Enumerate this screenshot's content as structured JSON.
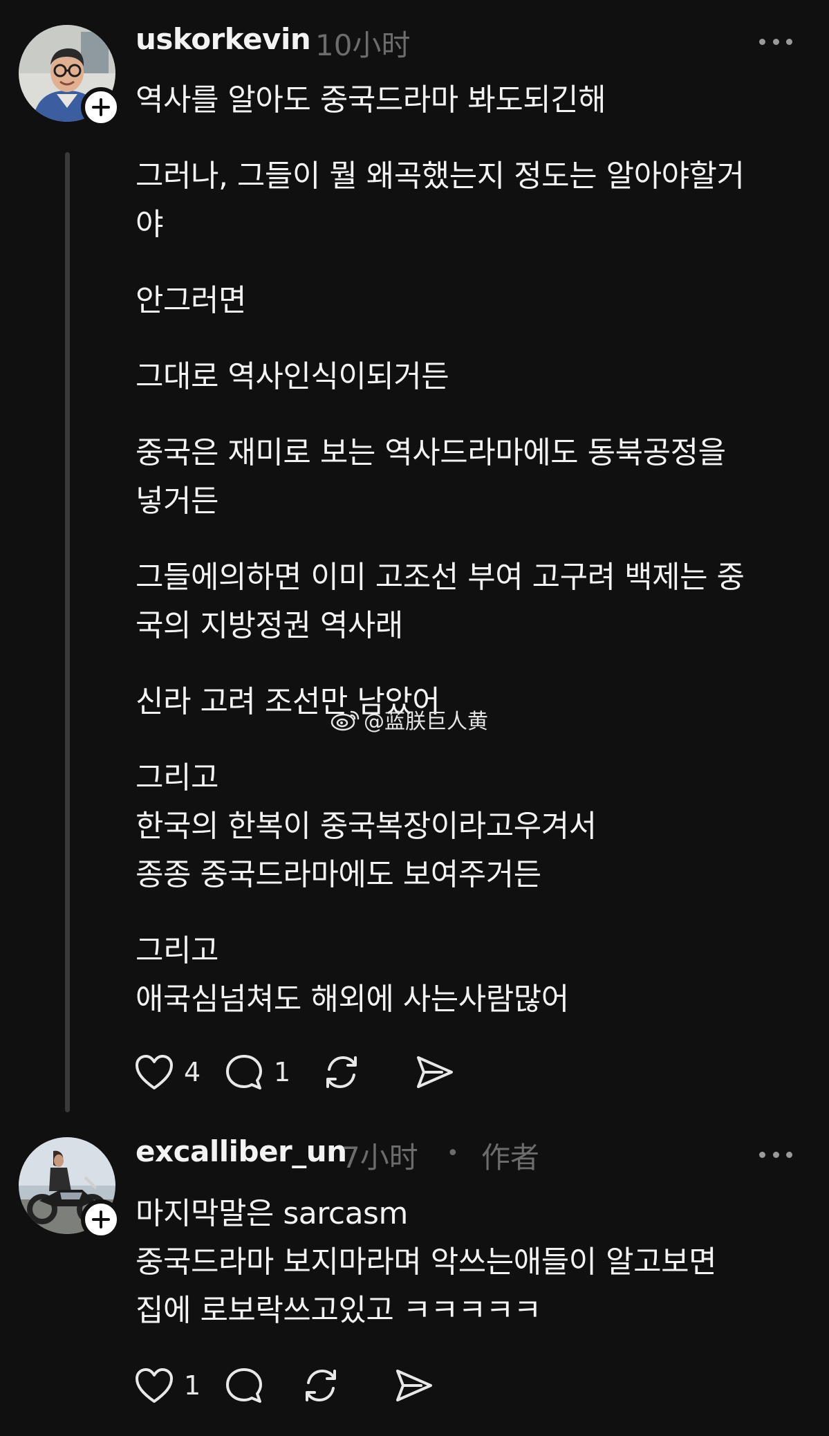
{
  "posts": [
    {
      "username": "uskorkevin",
      "timestamp": "10小时",
      "paragraphs": [
        "역사를 알아도 중국드라마 봐도되긴해"
      ],
      "replies_block": [
        "그러나, 그들이 뭘 왜곡했는지 정도는 알아야할거\n야",
        "안그러면",
        "그대로 역사인식이되거든",
        "중국은 재미로 보는 역사드라마에도 동북공정을\n넣거든",
        "그들에의하면 이미 고조선 부여 고구려 백제는 중\n국의 지방정권 역사래",
        "신라 고려 조선만 남았어",
        "그리고\n한국의 한복이 중국복장이라고우겨서\n종종 중국드라마에도 보여주거든",
        "그리고\n애국심넘쳐도 해외에 사는사람많어"
      ],
      "likes": "4",
      "comments": "1"
    },
    {
      "username": "excalliber_un",
      "timestamp": "7小时",
      "separator": "•",
      "author_tag": "作者",
      "paragraphs": [
        "마지막말은 sarcasm\n중국드라마 보지마라며 악쓰는애들이 알고보면\n집에 로보락쓰고있고 ㅋㅋㅋㅋㅋ"
      ],
      "likes": "1"
    }
  ],
  "watermark": {
    "text": "@蓝朕巨人黄",
    "icon": "weibo-icon"
  },
  "icons": {
    "like": "heart-icon",
    "comment": "speech-bubble-icon",
    "repost": "repost-icon",
    "share": "send-icon",
    "more": "more-dots-icon",
    "follow": "plus-icon"
  },
  "colors": {
    "background": "#101010",
    "text": "#f3f3f3",
    "muted": "#6c6c6c",
    "thread_line": "#3a3a3a"
  }
}
